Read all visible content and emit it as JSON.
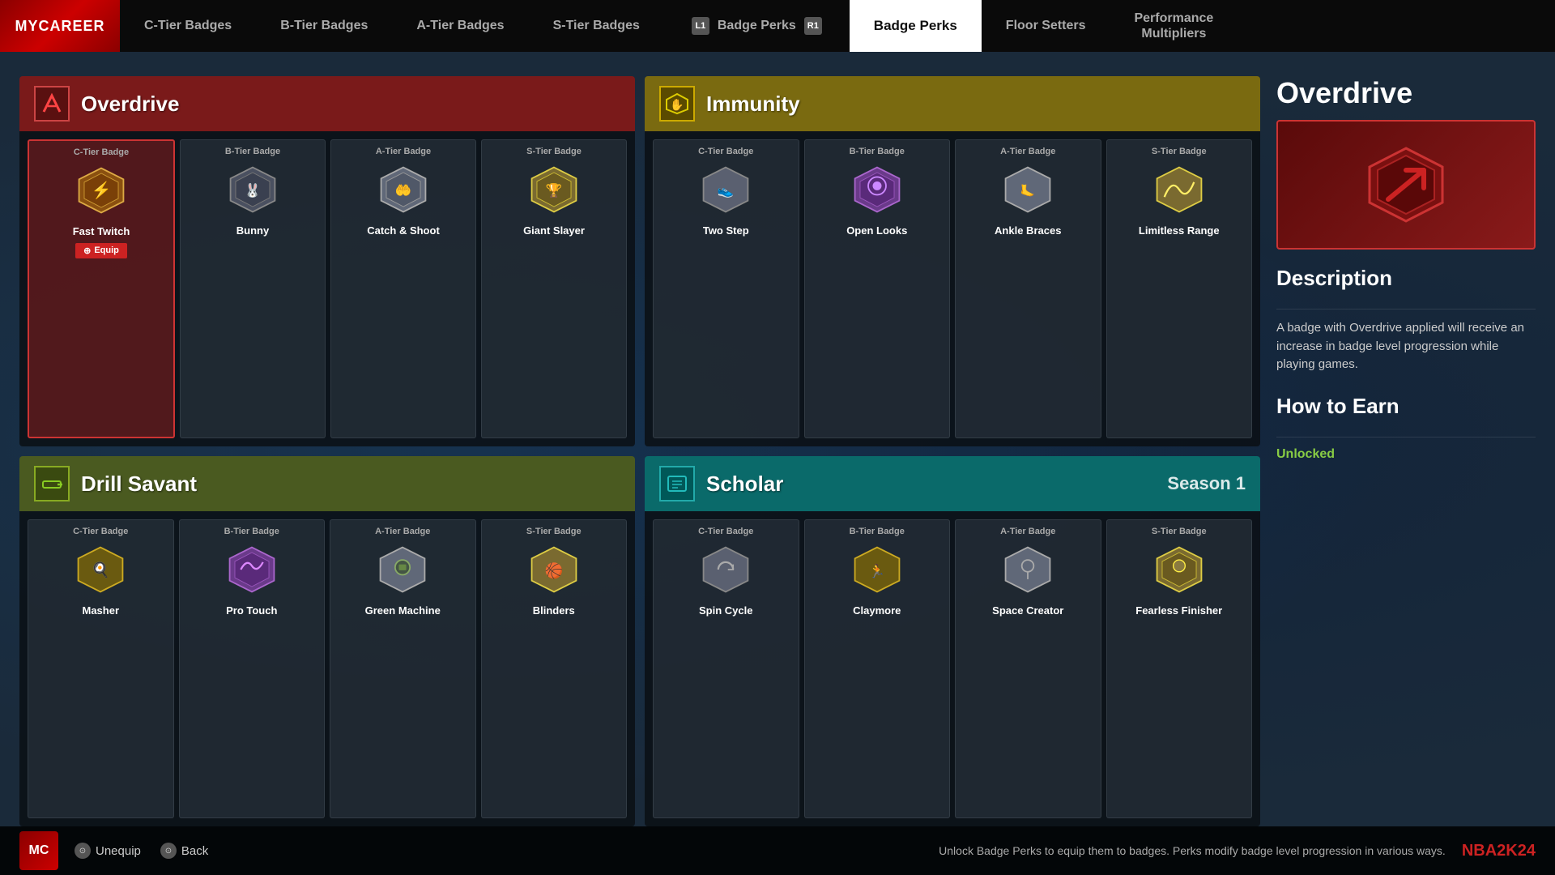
{
  "app": {
    "title": "MyCAREER",
    "logo_text": "MyCAREER"
  },
  "nav": {
    "items": [
      {
        "id": "c-tier",
        "label": "C-Tier Badges",
        "active": false
      },
      {
        "id": "b-tier",
        "label": "B-Tier Badges",
        "active": false
      },
      {
        "id": "a-tier",
        "label": "A-Tier Badges",
        "active": false
      },
      {
        "id": "s-tier",
        "label": "S-Tier Badges",
        "active": false
      },
      {
        "id": "badge-perks",
        "label": "Badge Perks",
        "active": true
      },
      {
        "id": "floor-setters",
        "label": "Floor Setters",
        "active": false
      },
      {
        "id": "performance-multipliers",
        "label": "Performance\nMultipliers",
        "active": false
      }
    ],
    "l1_label": "L1",
    "r1_label": "R1"
  },
  "panels": {
    "overdrive": {
      "title": "Overdrive",
      "header_color": "overdrive",
      "badges": [
        {
          "tier": "C-Tier Badge",
          "name": "Fast Twitch",
          "selected": true,
          "color": "selected"
        },
        {
          "tier": "B-Tier Badge",
          "name": "Bunny",
          "selected": false,
          "color": "b"
        },
        {
          "tier": "A-Tier Badge",
          "name": "Catch & Shoot",
          "selected": false,
          "color": "a"
        },
        {
          "tier": "S-Tier Badge",
          "name": "Giant Slayer",
          "selected": false,
          "color": "s"
        }
      ],
      "equip_label": "Equip"
    },
    "immunity": {
      "title": "Immunity",
      "header_color": "immunity",
      "badges": [
        {
          "tier": "C-Tier Badge",
          "name": "Two Step",
          "selected": false,
          "color": "c"
        },
        {
          "tier": "B-Tier Badge",
          "name": "Open Looks",
          "selected": false,
          "color": "purple"
        },
        {
          "tier": "A-Tier Badge",
          "name": "Ankle Braces",
          "selected": false,
          "color": "a"
        },
        {
          "tier": "S-Tier Badge",
          "name": "Limitless Range",
          "selected": false,
          "color": "s"
        }
      ]
    },
    "drill_savant": {
      "title": "Drill Savant",
      "header_color": "drill-savant",
      "badges": [
        {
          "tier": "C-Tier Badge",
          "name": "Masher",
          "selected": false,
          "color": "c-gold"
        },
        {
          "tier": "B-Tier Badge",
          "name": "Pro Touch",
          "selected": false,
          "color": "purple"
        },
        {
          "tier": "A-Tier Badge",
          "name": "Green Machine",
          "selected": false,
          "color": "a"
        },
        {
          "tier": "S-Tier Badge",
          "name": "Blinders",
          "selected": false,
          "color": "s"
        }
      ]
    },
    "scholar": {
      "title": "Scholar",
      "season_label": "Season 1",
      "header_color": "scholar",
      "badges": [
        {
          "tier": "C-Tier Badge",
          "name": "Spin Cycle",
          "selected": false,
          "color": "c"
        },
        {
          "tier": "B-Tier Badge",
          "name": "Claymore",
          "selected": false,
          "color": "c-gold"
        },
        {
          "tier": "A-Tier Badge",
          "name": "Space Creator",
          "selected": false,
          "color": "a"
        },
        {
          "tier": "S-Tier Badge",
          "name": "Fearless Finisher",
          "selected": false,
          "color": "s"
        }
      ]
    }
  },
  "description": {
    "title": "Overdrive",
    "section_description": "Description",
    "text": "A badge with Overdrive applied will receive an increase in badge level progression while playing games.",
    "section_earn": "How to Earn",
    "earn_status": "Unlocked"
  },
  "bottombar": {
    "mc_label": "MC",
    "unequip_label": "Unequip",
    "back_label": "Back",
    "hint": "Unlock Badge Perks to equip them to badges. Perks modify badge level progression in various ways.",
    "nba2k_logo": "NBA2K24"
  }
}
